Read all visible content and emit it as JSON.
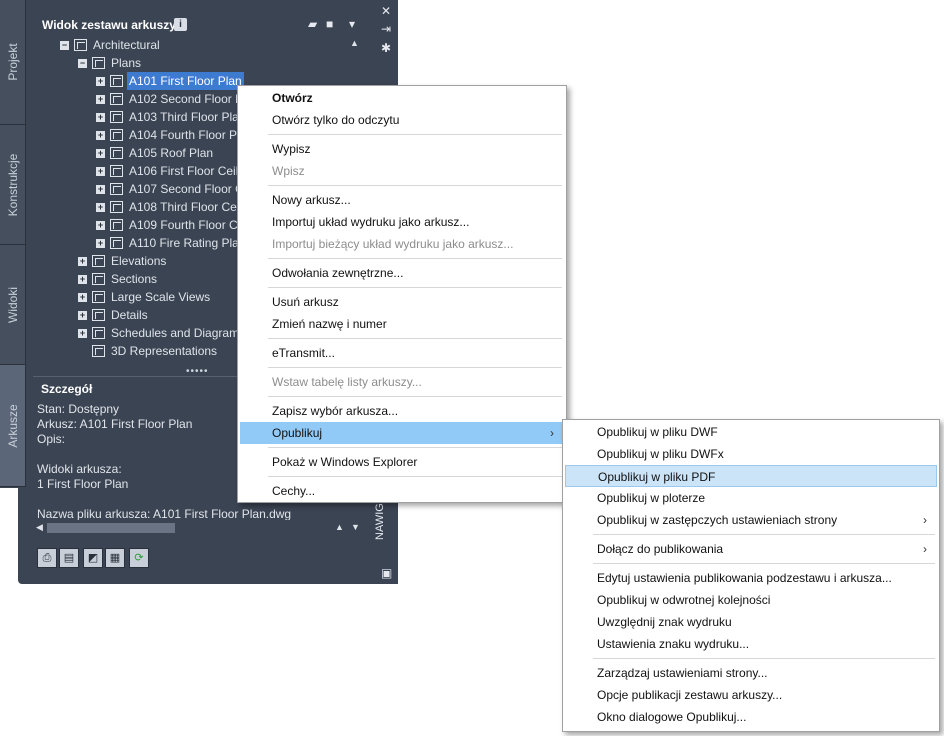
{
  "panel": {
    "title": "Widok zestawu arkuszy",
    "info_badge": "i",
    "side_tabs": [
      "Projekt",
      "Konstrukcje",
      "Widoki",
      "Arkusze"
    ],
    "nav_label": "NAWIGAT",
    "tree": [
      {
        "level": 0,
        "toggle": "−",
        "label": "Architectural"
      },
      {
        "level": 1,
        "toggle": "−",
        "label": "Plans"
      },
      {
        "level": 2,
        "toggle": "+",
        "label": "A101 First Floor Plan",
        "selected": true
      },
      {
        "level": 2,
        "toggle": "+",
        "label": "A102 Second Floor P"
      },
      {
        "level": 2,
        "toggle": "+",
        "label": "A103 Third Floor Pla"
      },
      {
        "level": 2,
        "toggle": "+",
        "label": "A104 Fourth Floor P"
      },
      {
        "level": 2,
        "toggle": "+",
        "label": "A105 Roof Plan"
      },
      {
        "level": 2,
        "toggle": "+",
        "label": "A106 First Floor Ceil"
      },
      {
        "level": 2,
        "toggle": "+",
        "label": "A107 Second Floor C"
      },
      {
        "level": 2,
        "toggle": "+",
        "label": "A108 Third Floor Ce"
      },
      {
        "level": 2,
        "toggle": "+",
        "label": "A109 Fourth Floor C"
      },
      {
        "level": 2,
        "toggle": "+",
        "label": "A110 Fire Rating Pla"
      },
      {
        "level": 1,
        "toggle": "+",
        "label": "Elevations"
      },
      {
        "level": 1,
        "toggle": "+",
        "label": "Sections"
      },
      {
        "level": 1,
        "toggle": "+",
        "label": "Large Scale Views"
      },
      {
        "level": 1,
        "toggle": "+",
        "label": "Details"
      },
      {
        "level": 1,
        "toggle": "+",
        "label": "Schedules and Diagram"
      },
      {
        "level": 1,
        "toggle": "",
        "label": "3D Representations"
      }
    ],
    "detail_title": "Szczegół",
    "detail_lines": [
      "Stan: Dostępny",
      "Arkusz: A101 First Floor Plan",
      "Opis:",
      "",
      "Widoki arkusza:",
      "1 First Floor Plan",
      "",
      "Nazwa pliku arkusza: A101 First Floor Plan.dwg"
    ]
  },
  "context_menu": [
    {
      "label": "Otwórz",
      "bold": true
    },
    {
      "label": "Otwórz tylko do odczytu"
    },
    {
      "sep": true
    },
    {
      "label": "Wypisz"
    },
    {
      "label": "Wpisz",
      "disabled": true
    },
    {
      "sep": true
    },
    {
      "label": "Nowy arkusz..."
    },
    {
      "label": "Importuj układ wydruku jako arkusz..."
    },
    {
      "label": "Importuj bieżący układ wydruku jako arkusz...",
      "disabled": true
    },
    {
      "sep": true
    },
    {
      "label": "Odwołania zewnętrzne..."
    },
    {
      "sep": true
    },
    {
      "label": "Usuń arkusz"
    },
    {
      "label": "Zmień nazwę i numer"
    },
    {
      "sep": true
    },
    {
      "label": "eTransmit..."
    },
    {
      "sep": true
    },
    {
      "label": "Wstaw tabelę listy arkuszy...",
      "disabled": true
    },
    {
      "sep": true
    },
    {
      "label": "Zapisz wybór arkusza..."
    },
    {
      "label": "Opublikuj",
      "submenu": true,
      "highlighted": true
    },
    {
      "sep": true
    },
    {
      "label": "Pokaż w Windows Explorer"
    },
    {
      "sep": true
    },
    {
      "label": "Cechy..."
    }
  ],
  "submenu": [
    {
      "label": "Opublikuj w pliku DWF"
    },
    {
      "label": "Opublikuj w pliku DWFx"
    },
    {
      "label": "Opublikuj w pliku PDF",
      "highlighted": true
    },
    {
      "label": "Opublikuj w ploterze"
    },
    {
      "label": "Opublikuj w zastępczych ustawieniach strony",
      "submenu": true
    },
    {
      "sep": true
    },
    {
      "label": "Dołącz do publikowania",
      "submenu": true
    },
    {
      "sep": true
    },
    {
      "label": "Edytuj ustawienia publikowania podzestawu i arkusza..."
    },
    {
      "label": "Opublikuj w odwrotnej kolejności"
    },
    {
      "label": "Uwzględnij znak wydruku"
    },
    {
      "label": "Ustawienia znaku wydruku..."
    },
    {
      "sep": true
    },
    {
      "label": "Zarządzaj ustawieniami strony..."
    },
    {
      "label": "Opcje publikacji zestawu arkuszy..."
    },
    {
      "label": "Okno dialogowe Opublikuj..."
    }
  ],
  "submenu_arrow": "›",
  "colors": {
    "panel_bg": "#3b4453",
    "selection": "#3d7bd1",
    "menu_highlight": "#91c9f7"
  }
}
